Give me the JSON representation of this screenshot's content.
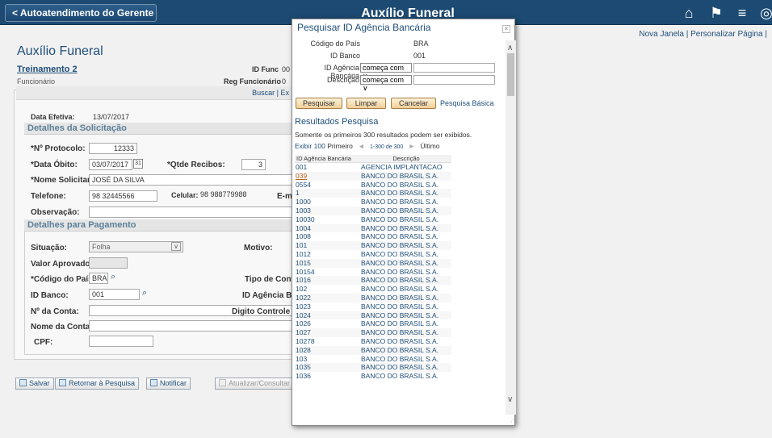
{
  "header": {
    "back_label": "< Autoatendimento do Gerente",
    "title": "Auxílio Funeral",
    "nav_icons": [
      "home-icon",
      "flag-icon",
      "menu-icon",
      "navbar-icon"
    ]
  },
  "links": {
    "new_window": "Nova Janela",
    "separator": "|",
    "personalize": "Personalizar Página",
    "separator2": "|"
  },
  "page": {
    "title": "Auxílio Funeral",
    "employee_name": "Treinamento 2",
    "employee_label": "Funcionário",
    "id_func_label": "ID Func",
    "id_func_value": "00",
    "reg_func_label": "Reg Funcionário",
    "reg_func_value": "0",
    "buscar": "Buscar | Ex"
  },
  "form": {
    "data_efetiva_label": "Data Efetiva:",
    "data_efetiva_value": "13/07/2017",
    "section1": "Detalhes da Solicitação",
    "protocolo_label": "*Nº Protocolo:",
    "protocolo_value": "12333",
    "data_obito_label": "*Data Óbito:",
    "data_obito_value": "03/07/2017",
    "calendar_icon_label": "31",
    "qtde_recibos_label": "*Qtde Recibos:",
    "qtde_recibos_value": "3",
    "nome_solicitante_label": "*Nome Solicitante:",
    "nome_solicitante_value": "JOSÉ DA SILVA",
    "telefone_label": "Telefone:",
    "telefone_value": "98 32445566",
    "celular_label": "Celular:",
    "celular_value": "98 988779988",
    "email_label": "E-m",
    "observacao_label": "Observação:",
    "section2": "Detalhes para Pagamento",
    "situacao_label": "Situação:",
    "situacao_value": "Folha",
    "motivo_label": "Motivo:",
    "valor_aprovado_label": "Valor Aprovado:",
    "codigo_pais_label": "*Código do País:",
    "codigo_pais_value": "BRA",
    "tipo_conta_label": "Tipo de Conta:",
    "id_banco_label": "ID Banco:",
    "id_banco_value": "001",
    "id_agencia_label": "ID Agência Ban",
    "num_conta_label": "Nº da Conta:",
    "digito_label": "Digito Controle",
    "nome_conta_label": "Nome da Conta:",
    "cpf_label": "CPF:"
  },
  "buttons": {
    "salvar": "Salvar",
    "retornar": "Retornar à Pesquisa",
    "notificar": "Notificar",
    "atualizar": "Atualizar/Consultar"
  },
  "modal": {
    "title": "Pesquisar ID Agência Bancária",
    "close": "×",
    "codigo_pais_label": "Código do País",
    "codigo_pais_value": "BRA",
    "id_banco_label": "ID Banco",
    "id_banco_value": "001",
    "id_agencia_label": "ID Agência Bancária",
    "id_agencia_op": "começa com",
    "descricao_label": "Descrição",
    "descricao_op": "começa com",
    "btn_pesquisar": "Pesquisar",
    "btn_limpar": "Limpar",
    "btn_cancelar": "Cancelar",
    "pesquisa_basica": "Pesquisa Básica",
    "results_title": "Resultados Pesquisa",
    "results_note": "Somente os primeiros 300 resultados podem ser exibidos.",
    "exibir": "Exibir 100",
    "primeiro": "Primeiro",
    "range": "1-300 de 300",
    "ultimo": "Último",
    "col1": "ID Agência Bancária",
    "col2": "Descrição",
    "rows": [
      [
        "001",
        "AGENCIA IMPLANTACAO"
      ],
      [
        "039",
        "BANCO DO BRASIL S.A."
      ],
      [
        "0554",
        "BANCO DO BRASIL S.A."
      ],
      [
        "1",
        "BANCO DO BRASIL S.A."
      ],
      [
        "1000",
        "BANCO DO BRASIL S.A."
      ],
      [
        "1003",
        "BANCO DO BRASIL S.A."
      ],
      [
        "10030",
        "BANCO DO BRASIL S.A."
      ],
      [
        "1004",
        "BANCO DO BRASIL S.A."
      ],
      [
        "1008",
        "BANCO DO BRASIL S.A."
      ],
      [
        "101",
        "BANCO DO BRASIL S.A."
      ],
      [
        "1012",
        "BANCO DO BRASIL S.A."
      ],
      [
        "1015",
        "BANCO DO BRASIL S.A."
      ],
      [
        "10154",
        "BANCO DO BRASIL S.A."
      ],
      [
        "1016",
        "BANCO DO BRASIL S.A."
      ],
      [
        "102",
        "BANCO DO BRASIL S.A."
      ],
      [
        "1022",
        "BANCO DO BRASIL S.A."
      ],
      [
        "1023",
        "BANCO DO BRASIL S.A."
      ],
      [
        "1024",
        "BANCO DO BRASIL S.A."
      ],
      [
        "1026",
        "BANCO DO BRASIL S.A."
      ],
      [
        "1027",
        "BANCO DO BRASIL S.A."
      ],
      [
        "10278",
        "BANCO DO BRASIL S.A."
      ],
      [
        "1028",
        "BANCO DO BRASIL S.A."
      ],
      [
        "103",
        "BANCO DO BRASIL S.A."
      ],
      [
        "1035",
        "BANCO DO BRASIL S.A."
      ],
      [
        "1036",
        "BANCO DO BRASIL S.A."
      ]
    ]
  },
  "colors": {
    "header_bg": "#1c4a72",
    "link": "#1f4e79",
    "button_bg": "#f1cf97"
  }
}
